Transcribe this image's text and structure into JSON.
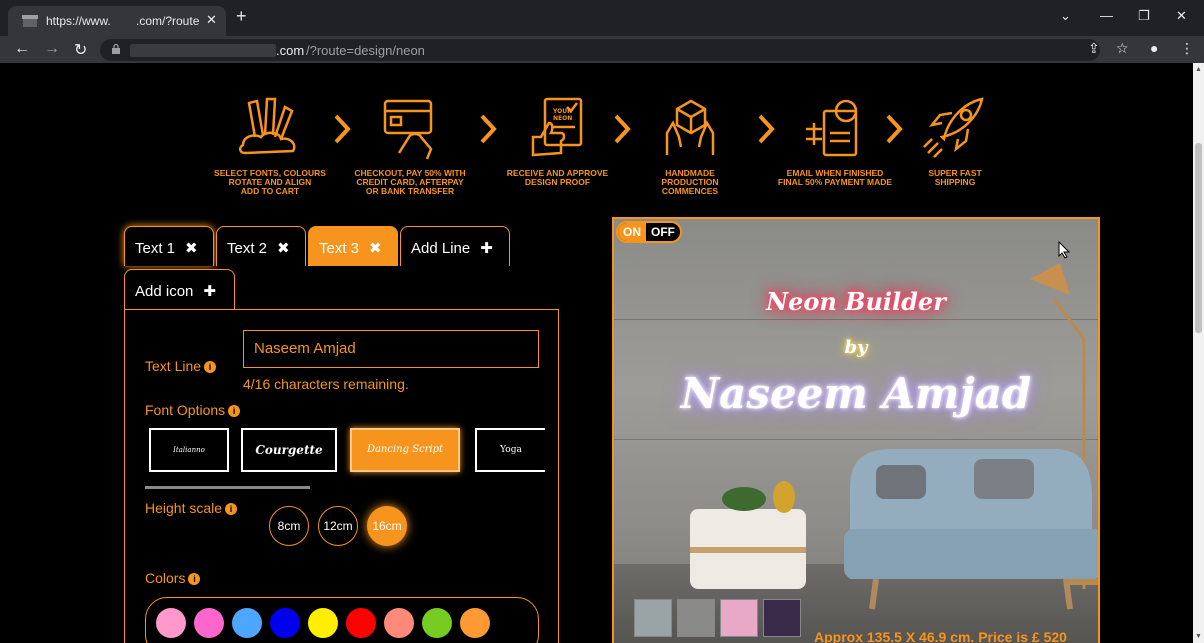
{
  "browser": {
    "tab_title_left": "https://www.",
    "tab_title_right": ".com/?route",
    "tab_close": "✕",
    "new_tab": "+",
    "url_domain": ".com",
    "url_path": "/?route=design/neon"
  },
  "steps": [
    {
      "label": "Select fonts, colours rotate and align add to cart"
    },
    {
      "label": "Checkout, pay 50% with credit card, afterpay or bank transfer"
    },
    {
      "label": "Receive and approve design proof"
    },
    {
      "label": "Handmade production commences"
    },
    {
      "label": "Email when finished final 50% payment made"
    },
    {
      "label": "Super fast shipping"
    }
  ],
  "step_lines": [
    [
      "SELECT FONTS, COLOURS",
      "ROTATE AND ALIGN",
      "ADD TO CART"
    ],
    [
      "CHECKOUT, PAY 50% WITH",
      "CREDIT CARD, AFTERPAY",
      "OR BANK TRANSFER"
    ],
    [
      "RECEIVE AND APPROVE",
      "DESIGN PROOF"
    ],
    [
      "HANDMADE",
      "PRODUCTION",
      "COMMENCES"
    ],
    [
      "EMAIL WHEN FINISHED",
      "FINAL 50% PAYMENT MADE"
    ],
    [
      "SUPER FAST",
      "SHIPPING"
    ]
  ],
  "tabs": {
    "text1": "Text 1",
    "text2": "Text 2",
    "text3": "Text 3",
    "add_line": "Add Line",
    "add_icon": "Add icon",
    "close_glyph": "✖",
    "plus_glyph": "✚"
  },
  "editor": {
    "text_line_label": "Text Line",
    "text_line_value": "Naseem Amjad",
    "chars_remaining": "4/16 characters remaining.",
    "font_options_label": "Font Options",
    "fonts": [
      "Italianno",
      "Courgette",
      "Dancing Script",
      "Yoga"
    ],
    "height_label": "Height scale",
    "heights": [
      "8cm",
      "12cm",
      "16cm"
    ],
    "selected_height": "16cm",
    "colors_label": "Colors",
    "colors": [
      "#ff99cc",
      "#ff66cc",
      "#4da6ff",
      "#0000ee",
      "#ffee00",
      "#ff0000",
      "#ff8a7a",
      "#77cc22",
      "#ff9933"
    ]
  },
  "preview": {
    "on": "ON",
    "off": "OFF",
    "line1": "Neon Builder",
    "line2": "by",
    "line3": "Naseem Amjad",
    "price": "Approx 135.5 X 46.9 cm. Price is £ 520"
  }
}
